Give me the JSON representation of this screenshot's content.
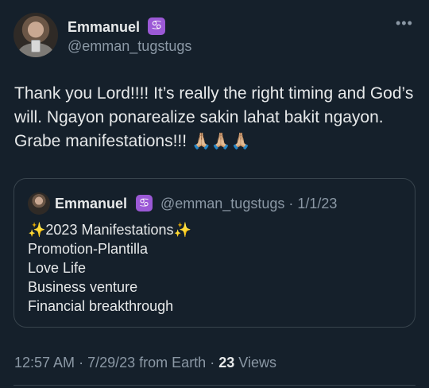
{
  "author": {
    "display_name": "Emmanuel",
    "badge_icon": "cancer-zodiac-icon",
    "badge_glyph": "♋",
    "badge_color": "#9b59d6",
    "handle": "@emman_tugstugs"
  },
  "more_menu": {
    "icon": "more-horizontal-icon",
    "glyph": "•••"
  },
  "tweet": {
    "text": "Thank you Lord!!!! It’s really the right timing and God’s will. Ngayon ponarealize sakin lahat bakit ngayon. Grabe manifestations!!!",
    "emojis": "🙏🏼🙏🏼🙏🏼"
  },
  "quoted_tweet": {
    "display_name": "Emmanuel",
    "badge_glyph": "♋",
    "meta": "@emman_tugstugs · 1/1/23",
    "lines": [
      "✨2023 Manifestations✨",
      "Promotion-Plantilla",
      "Love Life",
      "Business venture",
      "Financial breakthrough"
    ]
  },
  "footer": {
    "time": "12:57 AM",
    "date": "7/29/23",
    "source": "from Earth",
    "views_count": "23",
    "views_label": "Views"
  },
  "colors": {
    "background": "#15202b",
    "text_primary": "#e7e9ea",
    "text_secondary": "#8b98a5",
    "border": "#38444d"
  }
}
